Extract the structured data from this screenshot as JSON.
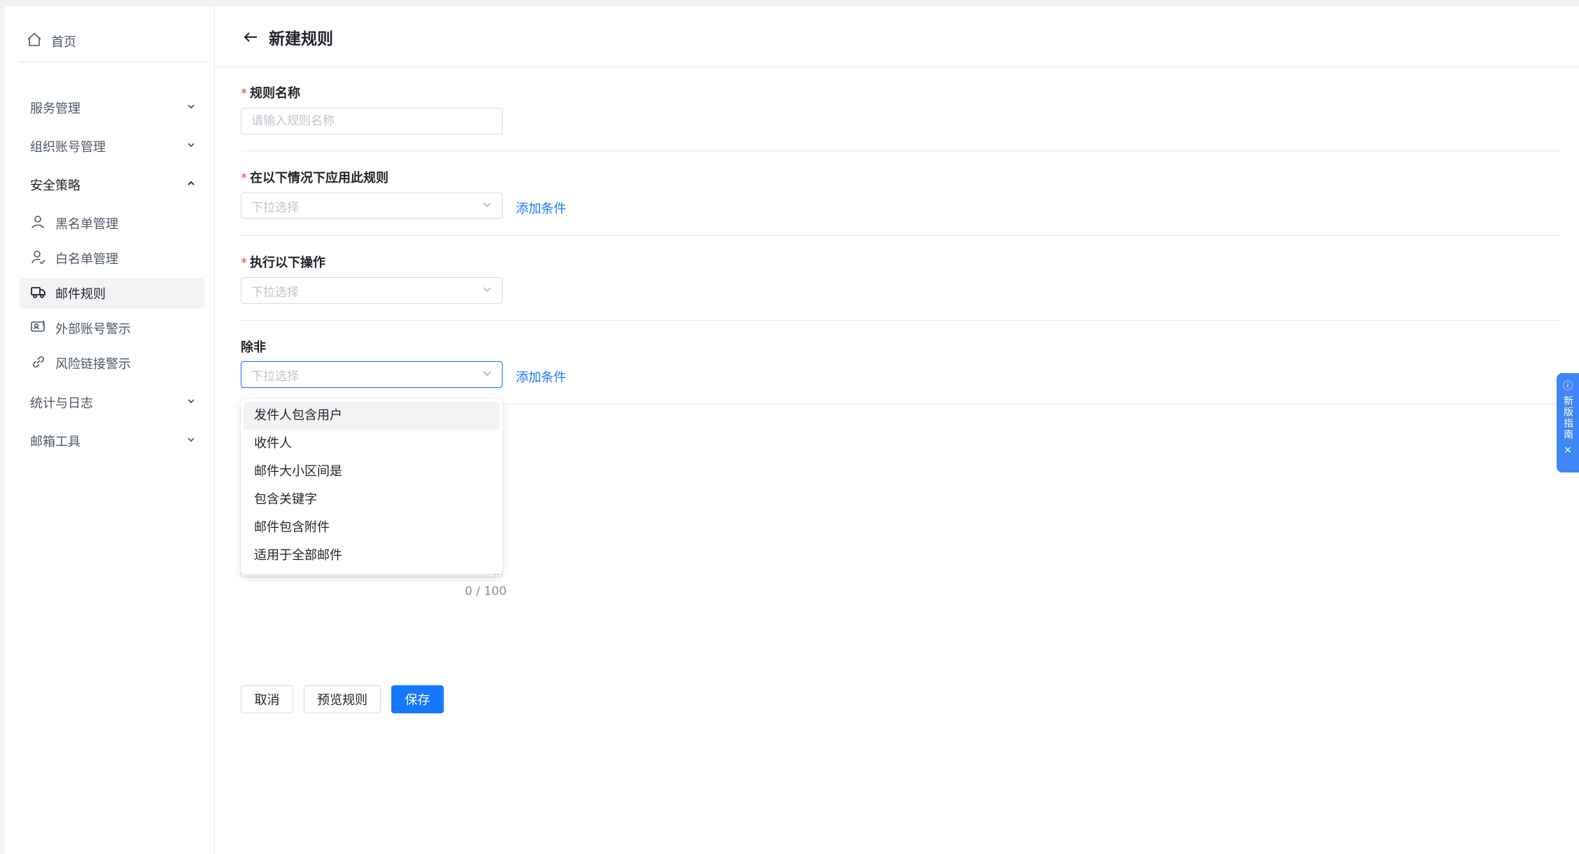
{
  "sidebar": {
    "home_label": "首页",
    "groups": [
      {
        "label": "服务管理"
      },
      {
        "label": "组织账号管理"
      },
      {
        "label": "安全策略"
      },
      {
        "label": "统计与日志"
      },
      {
        "label": "邮箱工具"
      }
    ],
    "security_items": [
      {
        "label": "黑名单管理",
        "icon": "user-icon"
      },
      {
        "label": "白名单管理",
        "icon": "user-check-icon"
      },
      {
        "label": "邮件规则",
        "icon": "truck-icon",
        "active": true
      },
      {
        "label": "外部账号警示",
        "icon": "account-warning-icon"
      },
      {
        "label": "风险链接警示",
        "icon": "link-icon"
      }
    ]
  },
  "header": {
    "title": "新建规则"
  },
  "form": {
    "rule_name": {
      "label": "规则名称",
      "required_mark": "*",
      "placeholder": "请输入规则名称"
    },
    "conditions": {
      "label": "在以下情况下应用此规则",
      "required_mark": "*",
      "placeholder": "下拉选择",
      "add_label": "添加条件"
    },
    "actions": {
      "label": "执行以下操作",
      "required_mark": "*",
      "placeholder": "下拉选择"
    },
    "exceptions": {
      "label": "除非",
      "placeholder": "下拉选择",
      "add_label": "添加条件"
    },
    "textarea_counter": "0 / 100"
  },
  "dropdown": {
    "options": [
      "发件人包含用户",
      "收件人",
      "邮件大小区间是",
      "包含关键字",
      "邮件包含附件",
      "适用于全部邮件"
    ],
    "hovered_index": 0
  },
  "buttons": {
    "cancel": "取消",
    "preview": "预览规则",
    "save": "保存"
  },
  "guide": {
    "label": "新版指南",
    "info_icon": "ⓘ",
    "close_icon": "×"
  },
  "colors": {
    "primary": "#1677ff",
    "required": "#f53f3f",
    "guide": "#3f86f6"
  }
}
